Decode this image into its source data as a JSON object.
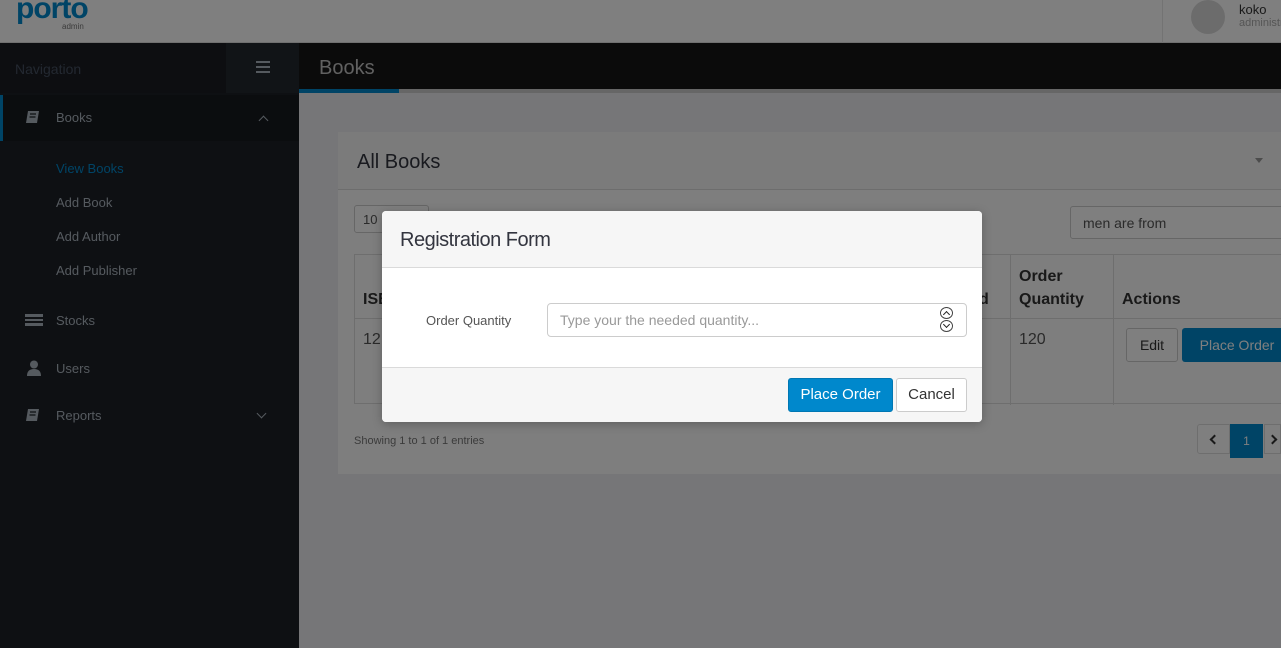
{
  "header": {
    "logo_text": "porto",
    "logo_sub": "admin",
    "user_name": "koko",
    "user_role": "administrator"
  },
  "sidebar": {
    "title": "Navigation",
    "items": [
      {
        "label": "Books",
        "icon": "book-icon",
        "expanded": true,
        "children": [
          "View Books",
          "Add Book",
          "Add Author",
          "Add Publisher"
        ]
      },
      {
        "label": "Stocks",
        "icon": "stocks-icon"
      },
      {
        "label": "Users",
        "icon": "user-icon"
      },
      {
        "label": "Reports",
        "icon": "book-icon"
      }
    ]
  },
  "page": {
    "title": "Books"
  },
  "panel": {
    "title": "All Books",
    "length_value": "10",
    "search_value": "men are from",
    "columns": [
      "ISBN",
      "d",
      "Order Quantity",
      "Actions"
    ],
    "row": {
      "isbn": "12",
      "order_quantity": "120"
    },
    "edit_label": "Edit",
    "place_order_label": "Place Order",
    "showing": "Showing 1 to 1 of 1 entries",
    "page_current": "1"
  },
  "modal": {
    "title": "Registration Form",
    "label": "Order Quantity",
    "placeholder": "Type your the needed quantity...",
    "submit_label": "Place Order",
    "cancel_label": "Cancel"
  },
  "colors": {
    "accent": "#0088cc",
    "sidebar_bg": "#1d2127"
  }
}
